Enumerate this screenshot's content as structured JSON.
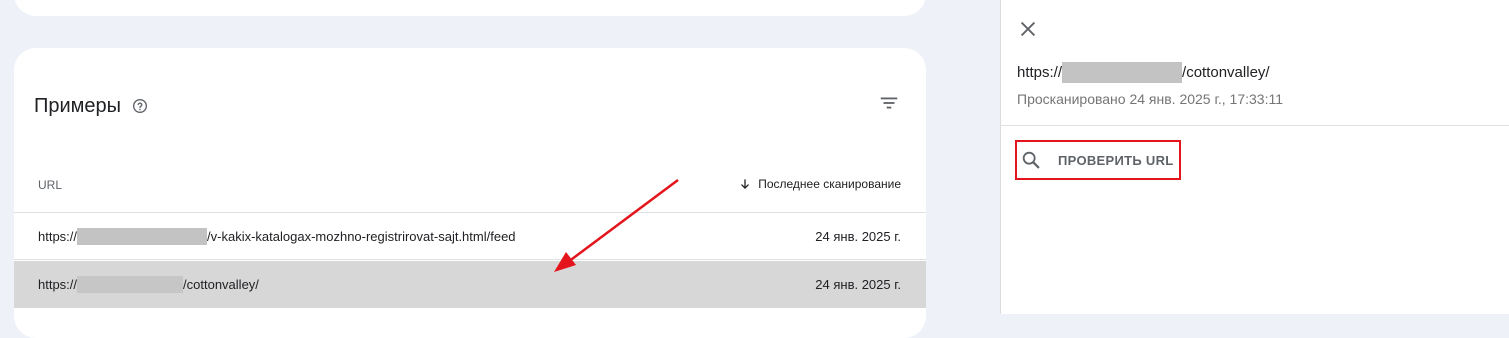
{
  "examples": {
    "title": "Примеры",
    "columns": {
      "url": "URL",
      "last_crawl": "Последнее сканирование"
    },
    "rows": [
      {
        "url_prefix": "https://",
        "url_suffix": "/v-kakix-katalogax-mozhno-registrirovat-sajt.html/feed",
        "date": "24 янв. 2025 г."
      },
      {
        "url_prefix": "https://",
        "url_suffix": "/cottonvalley/",
        "date": "24 янв. 2025 г.",
        "selected": true
      }
    ]
  },
  "side_panel": {
    "url_prefix": "https://",
    "url_suffix": "/cottonvalley/",
    "crawled_text": "Просканировано 24 янв. 2025 г., 17:33:11",
    "inspect_button": "ПРОВЕРИТЬ URL"
  },
  "colors": {
    "selected_row": "#d7d7d7",
    "highlight_box": "#e3141b",
    "annotation_arrow": "#e3141b",
    "redaction": "#c3c3c3"
  },
  "icons": [
    "help-icon",
    "filter-icon",
    "arrow-down-icon",
    "close-icon",
    "search-icon"
  ]
}
